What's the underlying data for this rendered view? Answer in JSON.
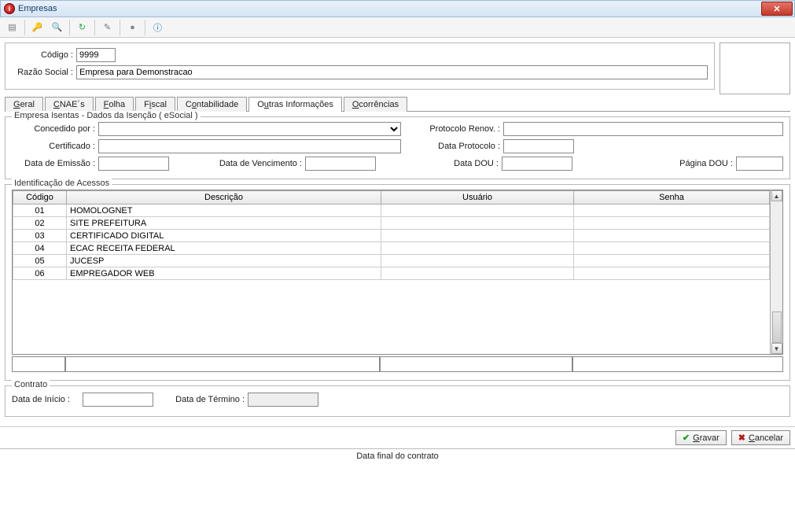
{
  "window": {
    "title": "Empresas"
  },
  "header": {
    "codigo_label": "Código :",
    "codigo_value": "9999",
    "razao_label": "Razão Social :",
    "razao_value": "Empresa para Demonstracao"
  },
  "tabs": {
    "geral": "Geral",
    "cnaes": "CNAE´s",
    "folha": "Folha",
    "fiscal": "Fiscal",
    "contab": "Contabilidade",
    "outras": "Outras Informações",
    "ocorr": "Ocorrências"
  },
  "isentas": {
    "legend": "Empresa Isentas - Dados da Isenção ( eSocial )",
    "concedido_label": "Concedido por :",
    "certificado_label": "Certificado :",
    "data_emissao_label": "Data de Emissão :",
    "data_venc_label": "Data de Vencimento :",
    "protocolo_renov_label": "Protocolo Renov. :",
    "data_protocolo_label": "Data Protocolo :",
    "data_dou_label": "Data DOU :",
    "pagina_dou_label": "Página DOU :",
    "concedido_value": "",
    "certificado_value": "",
    "data_emissao_value": "",
    "data_venc_value": "",
    "protocolo_renov_value": "",
    "data_protocolo_value": "",
    "data_dou_value": "",
    "pagina_dou_value": ""
  },
  "acessos": {
    "legend": "Identificação de Acessos",
    "headers": {
      "codigo": "Código",
      "descricao": "Descrição",
      "usuario": "Usuário",
      "senha": "Senha"
    },
    "rows": [
      {
        "codigo": "01",
        "descricao": "HOMOLOGNET",
        "usuario": "",
        "senha": ""
      },
      {
        "codigo": "02",
        "descricao": "SITE PREFEITURA",
        "usuario": "",
        "senha": ""
      },
      {
        "codigo": "03",
        "descricao": "CERTIFICADO DIGITAL",
        "usuario": "",
        "senha": ""
      },
      {
        "codigo": "04",
        "descricao": "ECAC RECEITA FEDERAL",
        "usuario": "",
        "senha": ""
      },
      {
        "codigo": "05",
        "descricao": "JUCESP",
        "usuario": "",
        "senha": ""
      },
      {
        "codigo": "06",
        "descricao": "EMPREGADOR WEB",
        "usuario": "",
        "senha": ""
      }
    ],
    "edit": {
      "codigo": "",
      "descricao": "",
      "usuario": "",
      "senha": ""
    }
  },
  "contrato": {
    "legend": "Contrato",
    "inicio_label": "Data de Início :",
    "termino_label": "Data de Término :",
    "inicio_value": "",
    "termino_value": ""
  },
  "buttons": {
    "gravar": "Gravar",
    "cancelar": "Cancelar"
  },
  "status": "Data final do contrato"
}
